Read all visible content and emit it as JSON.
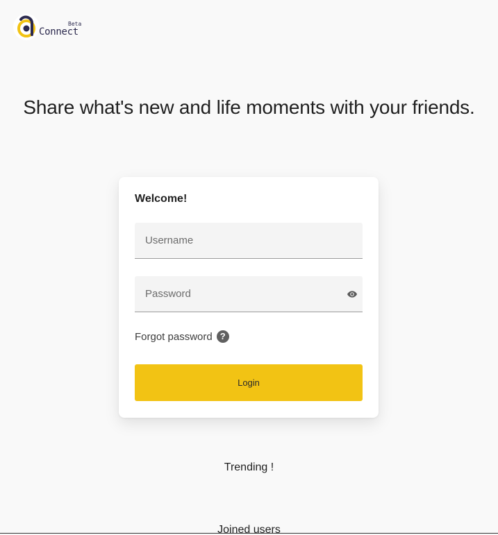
{
  "brand": {
    "name": "Connect",
    "badge": "Beta",
    "colors": {
      "navy": "#2c2a4e",
      "gold": "#f2c314"
    }
  },
  "hero": {
    "tagline": "Share what's new and life moments with your friends."
  },
  "login_card": {
    "title": "Welcome!",
    "username": {
      "placeholder": "Username",
      "value": ""
    },
    "password": {
      "placeholder": "Password",
      "value": "",
      "toggle_icon": "eye-icon"
    },
    "forgot_label": "Forgot password",
    "help_icon": "question-circle-icon",
    "login_label": "Login",
    "colors": {
      "button": "#f2c314",
      "card": "#ffffff",
      "field": "#f4f4f4"
    }
  },
  "sections": {
    "trending": "Trending !",
    "joined_users": "Joined users"
  }
}
